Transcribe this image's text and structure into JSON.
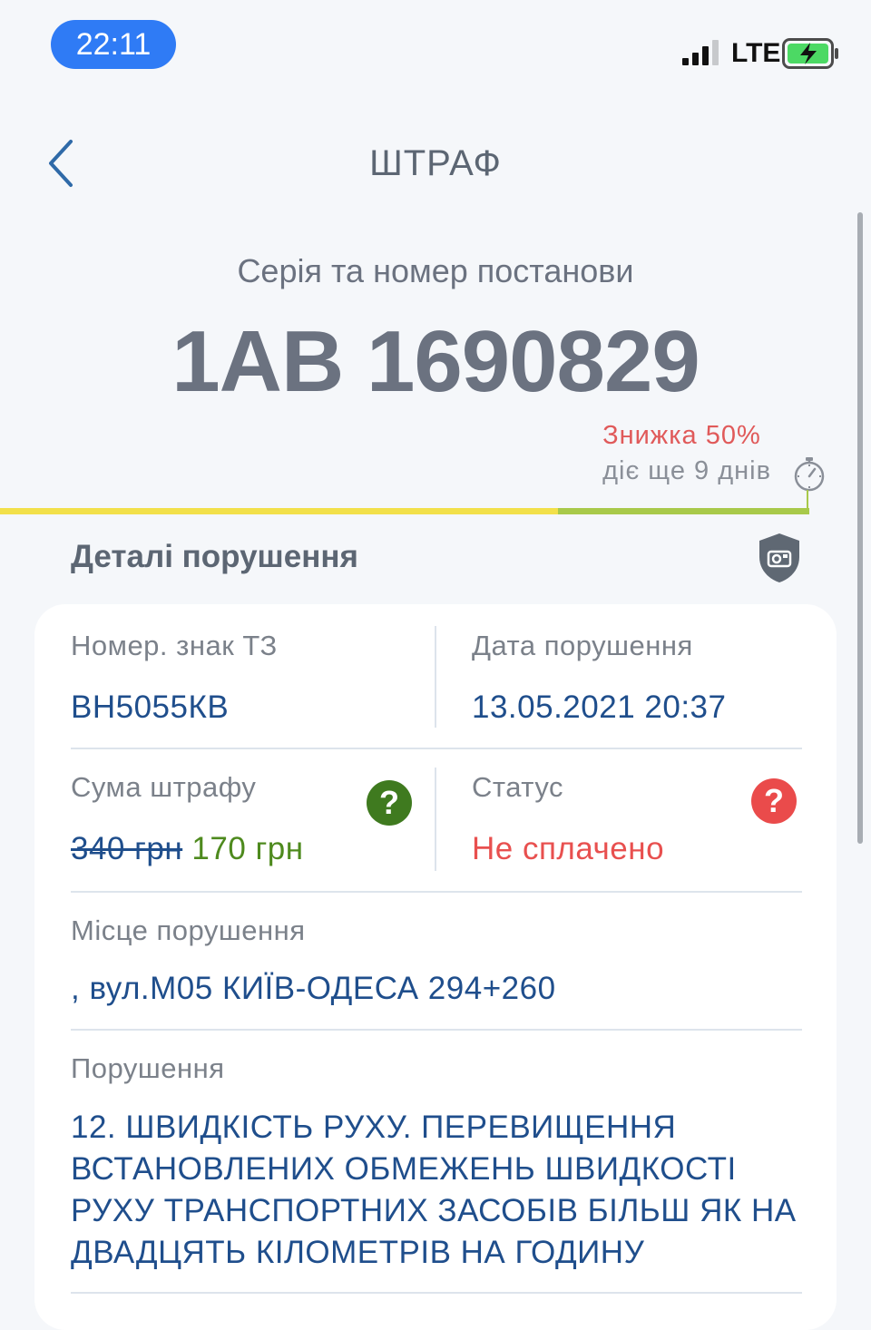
{
  "status_bar": {
    "time": "22:11",
    "network": "LTE",
    "icons": [
      "signal-icon",
      "battery-charging-icon"
    ]
  },
  "nav": {
    "title": "ШТРАФ",
    "back_icon": "chevron-left-icon"
  },
  "header": {
    "series_label": "Серія та номер постанови",
    "series_number": "1AB 1690829"
  },
  "discount": {
    "label": "Знижка 50%",
    "days_left": "діє ще 9 днів",
    "progress": 0.69,
    "icon": "stopwatch-icon"
  },
  "details": {
    "title": "Деталі порушення",
    "icon": "camera-shield-icon",
    "plate_label": "Номер. знак ТЗ",
    "plate_value": "ВН5055КВ",
    "date_label": "Дата порушення",
    "date_value": "13.05.2021 20:37",
    "fine_label": "Сума штрафу",
    "fine_old": "340 грн",
    "fine_new": "170 грн",
    "status_label": "Статус",
    "status_value": "Не сплачено",
    "help_glyph": "?",
    "location_label": "Місце порушення",
    "location_value": ", вул.М05 КИЇВ-ОДЕСА 294+260",
    "violation_label": "Порушення",
    "violation_value": "12. ШВИДКІСТЬ РУХУ. ПЕРЕВИЩЕННЯ ВСТАНОВЛЕНИХ ОБМЕЖЕНЬ ШВИДКОСТІ РУХУ ТРАНСПОРТНИХ ЗАСОБІВ БІЛЬШ ЯК НА ДВАДЦЯТЬ КІЛОМЕТРІВ НА ГОДИНУ"
  },
  "colors": {
    "accent_blue": "#1f4e8c",
    "status_red": "#e8504f",
    "discount_green": "#4e8a1e",
    "progress_yellow": "#f2e04a",
    "progress_green": "#a8c94a"
  }
}
